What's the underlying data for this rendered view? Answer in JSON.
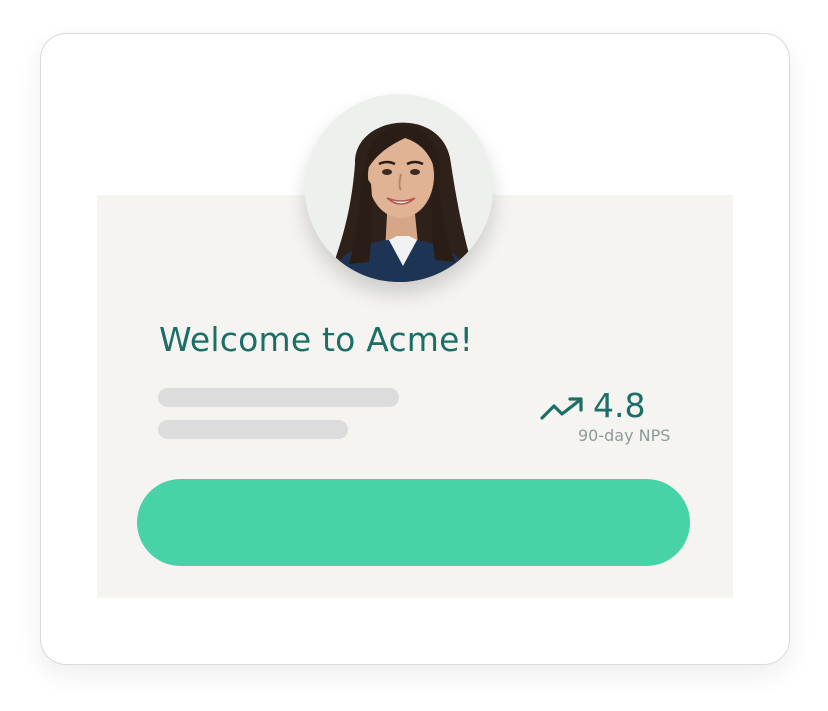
{
  "welcome": {
    "title": "Welcome to Acme!"
  },
  "nps": {
    "value": "4.8",
    "label": "90-day NPS",
    "icon": "trending-up-icon"
  },
  "cta": {
    "label": ""
  },
  "colors": {
    "accent": "#1b6f66",
    "button": "#47d3a7",
    "panel": "#f5f4f1",
    "skeleton": "#dcdcdc",
    "muted_text": "#8e9a98"
  }
}
